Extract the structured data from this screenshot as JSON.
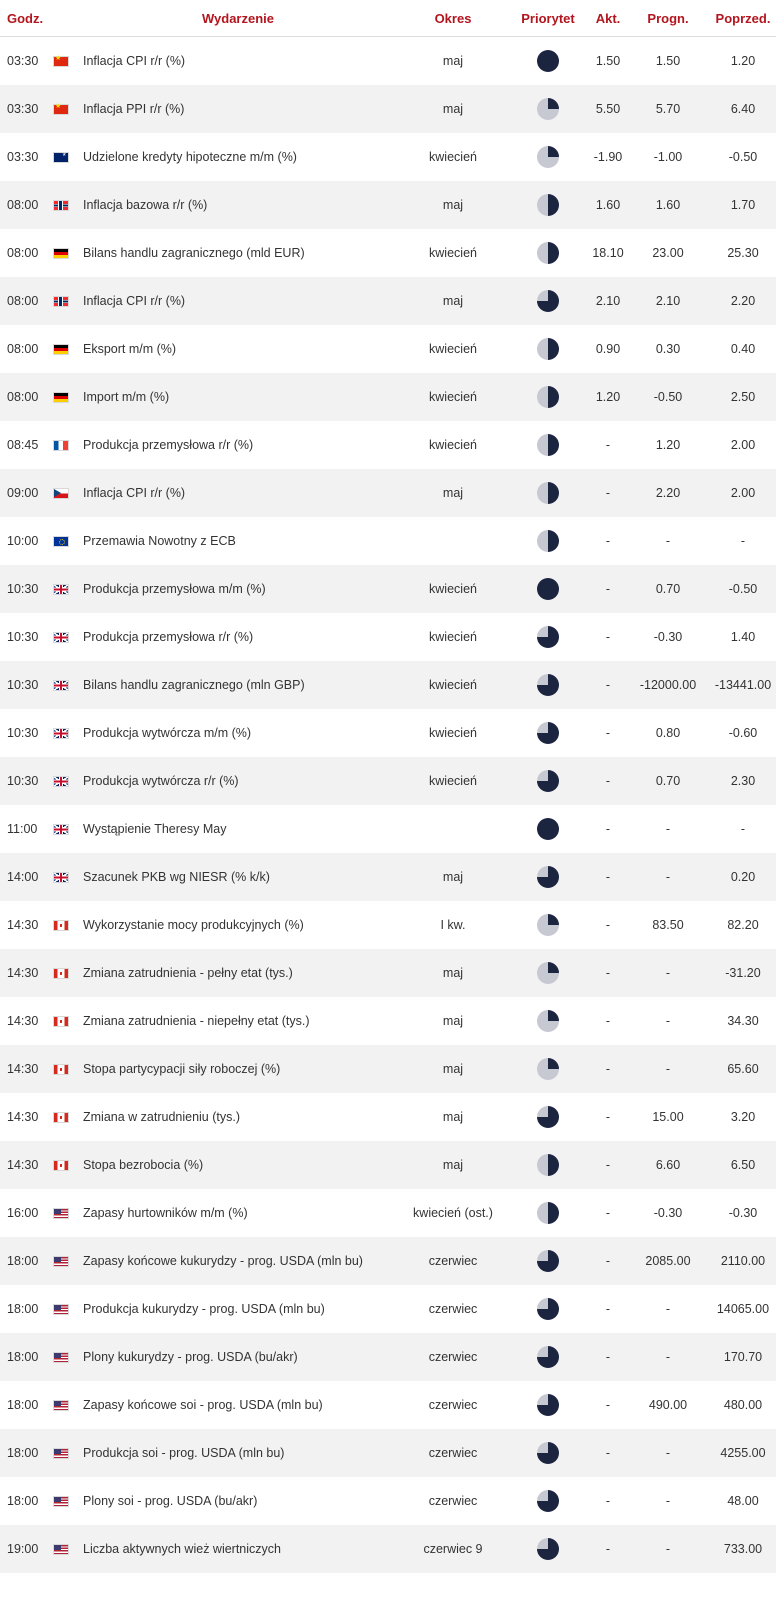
{
  "headers": {
    "time": "Godz.",
    "event": "Wydarzenie",
    "period": "Okres",
    "priority": "Priorytet",
    "actual": "Akt.",
    "forecast": "Progn.",
    "previous": "Poprzed."
  },
  "rows": [
    {
      "time": "03:30",
      "flag": "cn",
      "event": "Inflacja CPI r/r (%)",
      "period": "maj",
      "priority": 100,
      "actual": "1.50",
      "forecast": "1.50",
      "previous": "1.20"
    },
    {
      "time": "03:30",
      "flag": "cn",
      "event": "Inflacja PPI r/r (%)",
      "period": "maj",
      "priority": 25,
      "actual": "5.50",
      "forecast": "5.70",
      "previous": "6.40"
    },
    {
      "time": "03:30",
      "flag": "au",
      "event": "Udzielone kredyty hipoteczne m/m (%)",
      "period": "kwiecień",
      "priority": 25,
      "actual": "-1.90",
      "forecast": "-1.00",
      "previous": "-0.50"
    },
    {
      "time": "08:00",
      "flag": "no",
      "event": "Inflacja bazowa r/r (%)",
      "period": "maj",
      "priority": 50,
      "actual": "1.60",
      "forecast": "1.60",
      "previous": "1.70"
    },
    {
      "time": "08:00",
      "flag": "de",
      "event": "Bilans handlu zagranicznego (mld EUR)",
      "period": "kwiecień",
      "priority": 50,
      "actual": "18.10",
      "forecast": "23.00",
      "previous": "25.30"
    },
    {
      "time": "08:00",
      "flag": "no",
      "event": "Inflacja CPI r/r (%)",
      "period": "maj",
      "priority": 75,
      "actual": "2.10",
      "forecast": "2.10",
      "previous": "2.20"
    },
    {
      "time": "08:00",
      "flag": "de",
      "event": "Eksport m/m (%)",
      "period": "kwiecień",
      "priority": 50,
      "actual": "0.90",
      "forecast": "0.30",
      "previous": "0.40"
    },
    {
      "time": "08:00",
      "flag": "de",
      "event": "Import m/m (%)",
      "period": "kwiecień",
      "priority": 50,
      "actual": "1.20",
      "forecast": "-0.50",
      "previous": "2.50"
    },
    {
      "time": "08:45",
      "flag": "fr",
      "event": "Produkcja przemysłowa r/r (%)",
      "period": "kwiecień",
      "priority": 50,
      "actual": "-",
      "forecast": "1.20",
      "previous": "2.00"
    },
    {
      "time": "09:00",
      "flag": "cz",
      "event": "Inflacja CPI r/r (%)",
      "period": "maj",
      "priority": 50,
      "actual": "-",
      "forecast": "2.20",
      "previous": "2.00"
    },
    {
      "time": "10:00",
      "flag": "eu",
      "event": "Przemawia Nowotny z ECB",
      "period": "",
      "priority": 50,
      "actual": "-",
      "forecast": "-",
      "previous": "-"
    },
    {
      "time": "10:30",
      "flag": "gb",
      "event": "Produkcja przemysłowa m/m (%)",
      "period": "kwiecień",
      "priority": 100,
      "actual": "-",
      "forecast": "0.70",
      "previous": "-0.50"
    },
    {
      "time": "10:30",
      "flag": "gb",
      "event": "Produkcja przemysłowa r/r (%)",
      "period": "kwiecień",
      "priority": 75,
      "actual": "-",
      "forecast": "-0.30",
      "previous": "1.40"
    },
    {
      "time": "10:30",
      "flag": "gb",
      "event": "Bilans handlu zagranicznego (mln GBP)",
      "period": "kwiecień",
      "priority": 75,
      "actual": "-",
      "forecast": "-12000.00",
      "previous": "-13441.00"
    },
    {
      "time": "10:30",
      "flag": "gb",
      "event": "Produkcja wytwórcza m/m (%)",
      "period": "kwiecień",
      "priority": 75,
      "actual": "-",
      "forecast": "0.80",
      "previous": "-0.60"
    },
    {
      "time": "10:30",
      "flag": "gb",
      "event": "Produkcja wytwórcza r/r (%)",
      "period": "kwiecień",
      "priority": 75,
      "actual": "-",
      "forecast": "0.70",
      "previous": "2.30"
    },
    {
      "time": "11:00",
      "flag": "gb",
      "event": "Wystąpienie Theresy May",
      "period": "",
      "priority": 100,
      "actual": "-",
      "forecast": "-",
      "previous": "-"
    },
    {
      "time": "14:00",
      "flag": "gb",
      "event": "Szacunek PKB wg NIESR (% k/k)",
      "period": "maj",
      "priority": 75,
      "actual": "-",
      "forecast": "-",
      "previous": "0.20"
    },
    {
      "time": "14:30",
      "flag": "ca",
      "event": "Wykorzystanie mocy produkcyjnych (%)",
      "period": "I kw.",
      "priority": 25,
      "actual": "-",
      "forecast": "83.50",
      "previous": "82.20"
    },
    {
      "time": "14:30",
      "flag": "ca",
      "event": "Zmiana zatrudnienia - pełny etat (tys.)",
      "period": "maj",
      "priority": 25,
      "actual": "-",
      "forecast": "-",
      "previous": "-31.20"
    },
    {
      "time": "14:30",
      "flag": "ca",
      "event": "Zmiana zatrudnienia - niepełny etat (tys.)",
      "period": "maj",
      "priority": 25,
      "actual": "-",
      "forecast": "-",
      "previous": "34.30"
    },
    {
      "time": "14:30",
      "flag": "ca",
      "event": "Stopa partycypacji siły roboczej (%)",
      "period": "maj",
      "priority": 25,
      "actual": "-",
      "forecast": "-",
      "previous": "65.60"
    },
    {
      "time": "14:30",
      "flag": "ca",
      "event": "Zmiana w zatrudnieniu (tys.)",
      "period": "maj",
      "priority": 75,
      "actual": "-",
      "forecast": "15.00",
      "previous": "3.20"
    },
    {
      "time": "14:30",
      "flag": "ca",
      "event": "Stopa bezrobocia (%)",
      "period": "maj",
      "priority": 50,
      "actual": "-",
      "forecast": "6.60",
      "previous": "6.50"
    },
    {
      "time": "16:00",
      "flag": "us",
      "event": "Zapasy hurtowników m/m (%)",
      "period": "kwiecień (ost.)",
      "priority": 50,
      "actual": "-",
      "forecast": "-0.30",
      "previous": "-0.30"
    },
    {
      "time": "18:00",
      "flag": "us",
      "event": "Zapasy końcowe kukurydzy - prog. USDA (mln bu)",
      "period": "czerwiec",
      "priority": 75,
      "actual": "-",
      "forecast": "2085.00",
      "previous": "2110.00"
    },
    {
      "time": "18:00",
      "flag": "us",
      "event": "Produkcja kukurydzy - prog. USDA (mln bu)",
      "period": "czerwiec",
      "priority": 75,
      "actual": "-",
      "forecast": "-",
      "previous": "14065.00"
    },
    {
      "time": "18:00",
      "flag": "us",
      "event": "Plony kukurydzy - prog. USDA (bu/akr)",
      "period": "czerwiec",
      "priority": 75,
      "actual": "-",
      "forecast": "-",
      "previous": "170.70"
    },
    {
      "time": "18:00",
      "flag": "us",
      "event": "Zapasy końcowe soi - prog. USDA (mln bu)",
      "period": "czerwiec",
      "priority": 75,
      "actual": "-",
      "forecast": "490.00",
      "previous": "480.00"
    },
    {
      "time": "18:00",
      "flag": "us",
      "event": "Produkcja soi - prog. USDA (mln bu)",
      "period": "czerwiec",
      "priority": 75,
      "actual": "-",
      "forecast": "-",
      "previous": "4255.00"
    },
    {
      "time": "18:00",
      "flag": "us",
      "event": "Plony soi - prog. USDA (bu/akr)",
      "period": "czerwiec",
      "priority": 75,
      "actual": "-",
      "forecast": "-",
      "previous": "48.00"
    },
    {
      "time": "19:00",
      "flag": "us",
      "event": "Liczba aktywnych wież wiertniczych",
      "period": "czerwiec 9",
      "priority": 75,
      "actual": "-",
      "forecast": "-",
      "previous": "733.00"
    }
  ]
}
